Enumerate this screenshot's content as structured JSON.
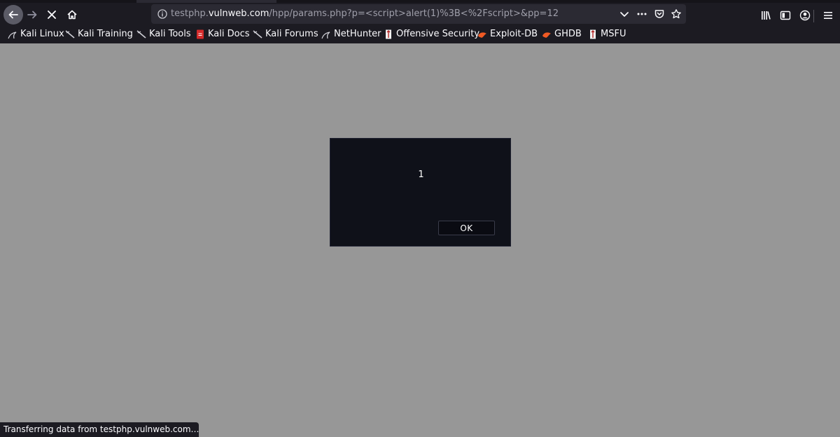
{
  "browser": {
    "url": {
      "prefix": "testphp.",
      "domain": "vulnweb.com",
      "path": "/hpp/params.php?p=<script>alert(1)%3B<%2Fscript>&pp=12"
    },
    "icons": {
      "back": "back-arrow-icon",
      "forward": "forward-arrow-icon",
      "stop": "stop-icon",
      "home": "home-icon",
      "info": "info-icon",
      "dropdown": "chevron-down-icon",
      "more": "more-dots-icon",
      "pocket": "pocket-icon",
      "bookmark_star": "star-icon",
      "library": "library-icon",
      "sidebar": "sidebar-icon",
      "account": "account-icon",
      "menu": "hamburger-menu-icon"
    }
  },
  "bookmarks": [
    {
      "label": "Kali Linux",
      "icon": "kali-dragon-icon"
    },
    {
      "label": "Kali Training",
      "icon": "kali-dragon-icon"
    },
    {
      "label": "Kali Tools",
      "icon": "kali-dragon-icon"
    },
    {
      "label": "Kali Docs",
      "icon": "kali-docs-icon"
    },
    {
      "label": "Kali Forums",
      "icon": "kali-dragon-icon"
    },
    {
      "label": "NetHunter",
      "icon": "nethunter-icon"
    },
    {
      "label": "Offensive Security",
      "icon": "offsec-icon"
    },
    {
      "label": "Exploit-DB",
      "icon": "exploitdb-icon"
    },
    {
      "label": "GHDB",
      "icon": "exploitdb-icon"
    },
    {
      "label": "MSFU",
      "icon": "offsec-icon"
    }
  ],
  "dialog": {
    "message": "1",
    "ok_label": "OK"
  },
  "status": {
    "text": "Transferring data from testphp.vulnweb.com…"
  },
  "colors": {
    "page_background": "#979797",
    "chrome": "#1c1b22",
    "urlbar": "#2b2a33",
    "dialog": "#0f1119"
  }
}
